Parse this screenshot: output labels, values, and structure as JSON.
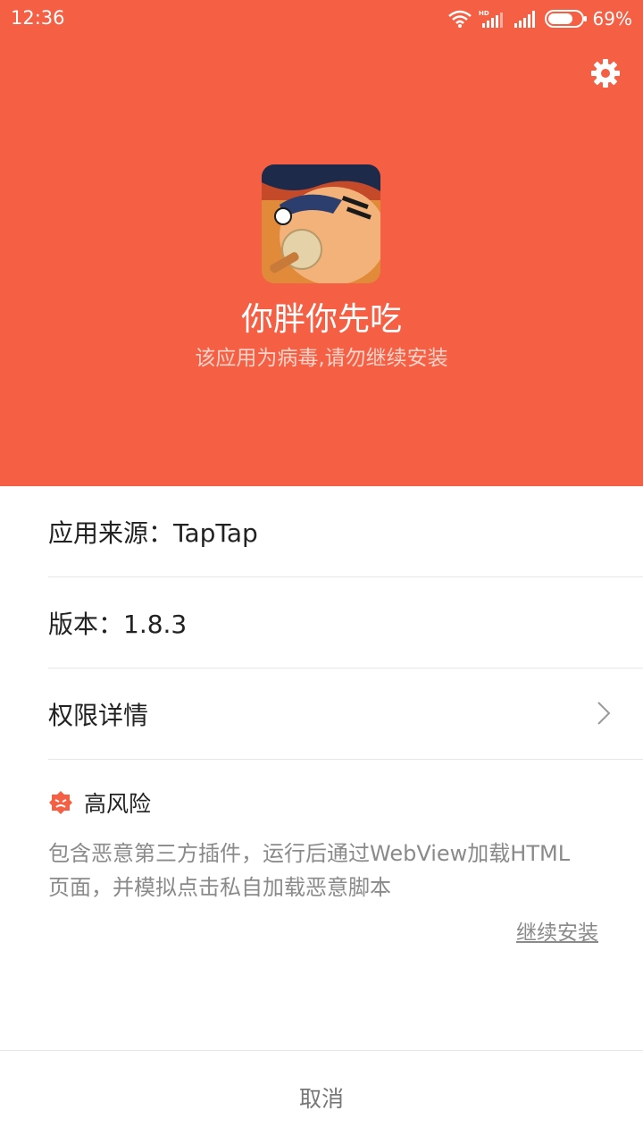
{
  "status_bar": {
    "time": "12:36",
    "battery_percent": "69%",
    "icons": [
      "wifi-icon",
      "hd-signal-icon",
      "signal-icon",
      "battery-icon"
    ]
  },
  "header": {
    "background_color": "#f55f44",
    "settings_icon": "gear-icon",
    "app_name": "你胖你先吃",
    "warning": "该应用为病毒,请勿继续安装"
  },
  "info": {
    "source": "应用来源：TapTap",
    "version": "版本：1.8.3",
    "permissions": "权限详情"
  },
  "risk": {
    "icon": "danger-icon",
    "icon_color": "#f55f44",
    "label": "高风险",
    "description": "包含恶意第三方插件，运行后通过WebView加载HTML页面，并模拟点击私自加载恶意脚本",
    "continue_link": "继续安装"
  },
  "footer": {
    "cancel": "取消"
  }
}
